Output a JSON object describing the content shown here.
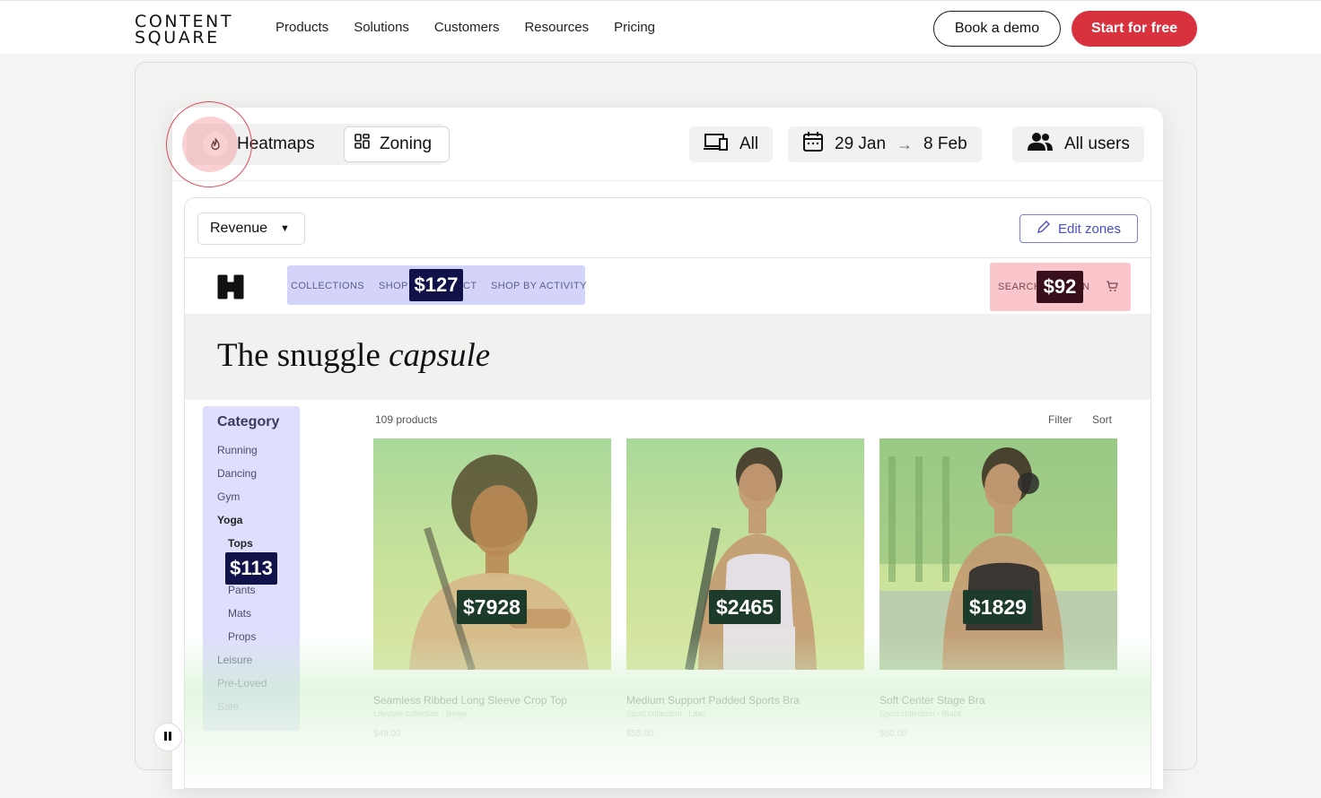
{
  "site": {
    "logo_line1": "CONTENT",
    "logo_line2": "SQUARE",
    "nav": [
      "Products",
      "Solutions",
      "Customers",
      "Resources",
      "Pricing"
    ],
    "book_demo": "Book a demo",
    "start_free": "Start for free"
  },
  "app": {
    "toggle_heatmaps": "Heatmaps",
    "toggle_zoning": "Zoning",
    "device_label": "All",
    "date_from": "29 Jan",
    "date_to": "8 Feb",
    "users_label": "All users",
    "metric_select": "Revenue",
    "edit_zones": "Edit zones"
  },
  "preview": {
    "nav_collections": "COLLECTIONS",
    "nav_shop": "SHOP",
    "nav_ct": "CT",
    "nav_activity": "SHOP BY ACTIVITY",
    "nav_search": "SEARCH",
    "nav_n": "N",
    "price_nav": "$127",
    "price_search": "$92",
    "hero_plain": "The snuggle ",
    "hero_italic": "capsule",
    "category_title": "Category",
    "categories": [
      "Running",
      "Dancing",
      "Gym",
      "Yoga",
      "Tops",
      "Pants",
      "Mats",
      "Props",
      "Leisure",
      "Pre-Loved",
      "Sale"
    ],
    "price_sidebar": "$113",
    "product_count": "109 products",
    "filter": "Filter",
    "sort": "Sort",
    "products": [
      {
        "name": "Seamless Ribbed Long Sleeve Crop Top",
        "collection": "Lifestyle collection",
        "color": "Beige",
        "price": "$49.00",
        "revenue": "$7928"
      },
      {
        "name": "Medium Support Padded Sports Bra",
        "collection": "Sport collection",
        "color": "Lilac",
        "price": "$55.00",
        "revenue": "$2465"
      },
      {
        "name": "Soft Center Stage Bra",
        "collection": "Sport collection",
        "color": "Black",
        "price": "$60.00",
        "revenue": "$1829"
      }
    ]
  },
  "colors": {
    "accent": "#d9323f",
    "zone_tag": "#12124a",
    "zone_tag_red": "#3a0f1c",
    "zone_tag_green": "#1d3b2a"
  },
  "icons": [
    "flame-icon",
    "grid-icon",
    "devices-icon",
    "calendar-icon",
    "arrow-right-icon",
    "users-icon",
    "caret-down-icon",
    "pencil-icon",
    "brand-icon",
    "cart-icon",
    "pause-icon"
  ]
}
